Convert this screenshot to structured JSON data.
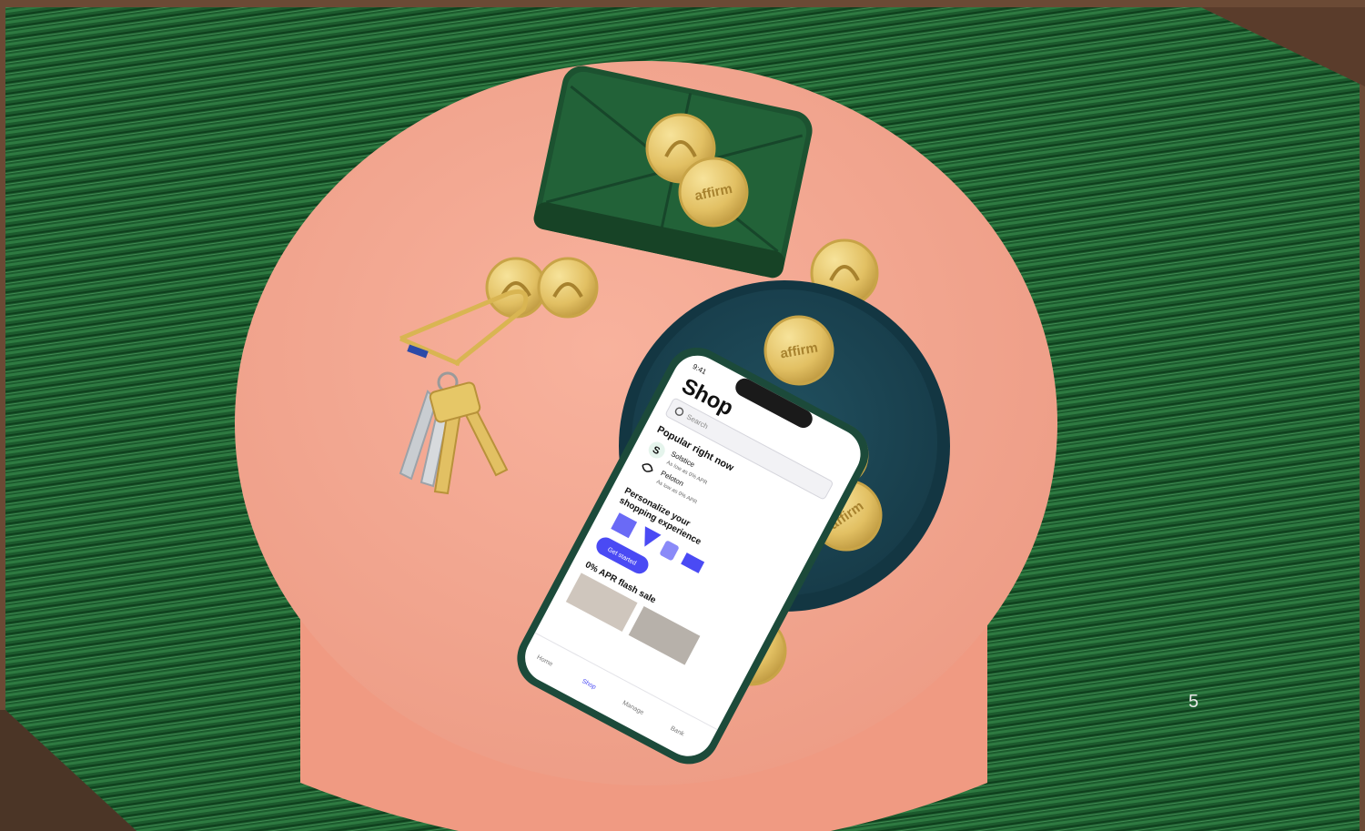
{
  "page": {
    "number": "5"
  },
  "phone": {
    "status_time": "9:41",
    "screen_title": "Shop",
    "search_placeholder": "Search",
    "popular_heading": "Popular right now",
    "merchants": [
      {
        "name": "Solstice",
        "subtitle": "As low as 0% APR",
        "initial": "S"
      },
      {
        "name": "Peloton",
        "subtitle": "As low as 0% APR"
      }
    ],
    "personalize_heading_line1": "Personalize your",
    "personalize_heading_line2": "shopping experience",
    "cta_label": "Get started",
    "flash_sale_heading": "0% APR flash sale",
    "tabs": [
      "Home",
      "Shop",
      "Manage",
      "Bank"
    ]
  },
  "coin_brand_text": "affirm",
  "colors": {
    "rug": "#1b5a2c",
    "table": "#f4a28c",
    "plate": "#1f4a5a",
    "wallet": "#1f5a34",
    "gold": "#e6c767",
    "accent": "#4a4af4"
  }
}
